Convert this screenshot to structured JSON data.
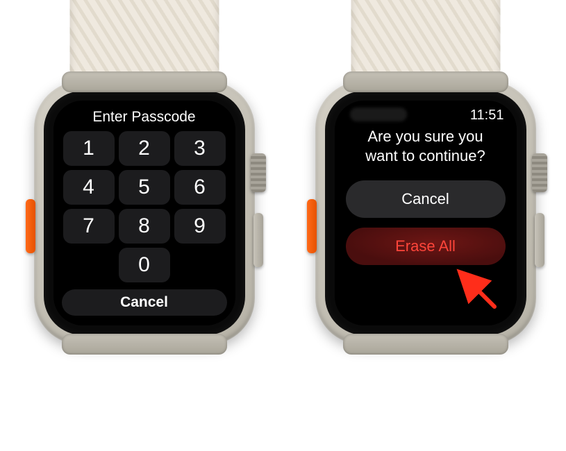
{
  "colors": {
    "destructive": "#ff453a",
    "key_bg": "#1c1c1e",
    "pill_gray": "#2a2a2c",
    "pill_red": "#4a0e0e"
  },
  "watch_left": {
    "title": "Enter Passcode",
    "keys": [
      "1",
      "2",
      "3",
      "4",
      "5",
      "6",
      "7",
      "8",
      "9",
      "0"
    ],
    "cancel_label": "Cancel"
  },
  "watch_right": {
    "time": "11:51",
    "message_line1": "Are you sure you",
    "message_line2": "want to continue?",
    "cancel_label": "Cancel",
    "erase_label": "Erase All"
  },
  "annotation": {
    "arrow_target": "erase-all-button",
    "arrow_color": "#ff2d1a"
  }
}
